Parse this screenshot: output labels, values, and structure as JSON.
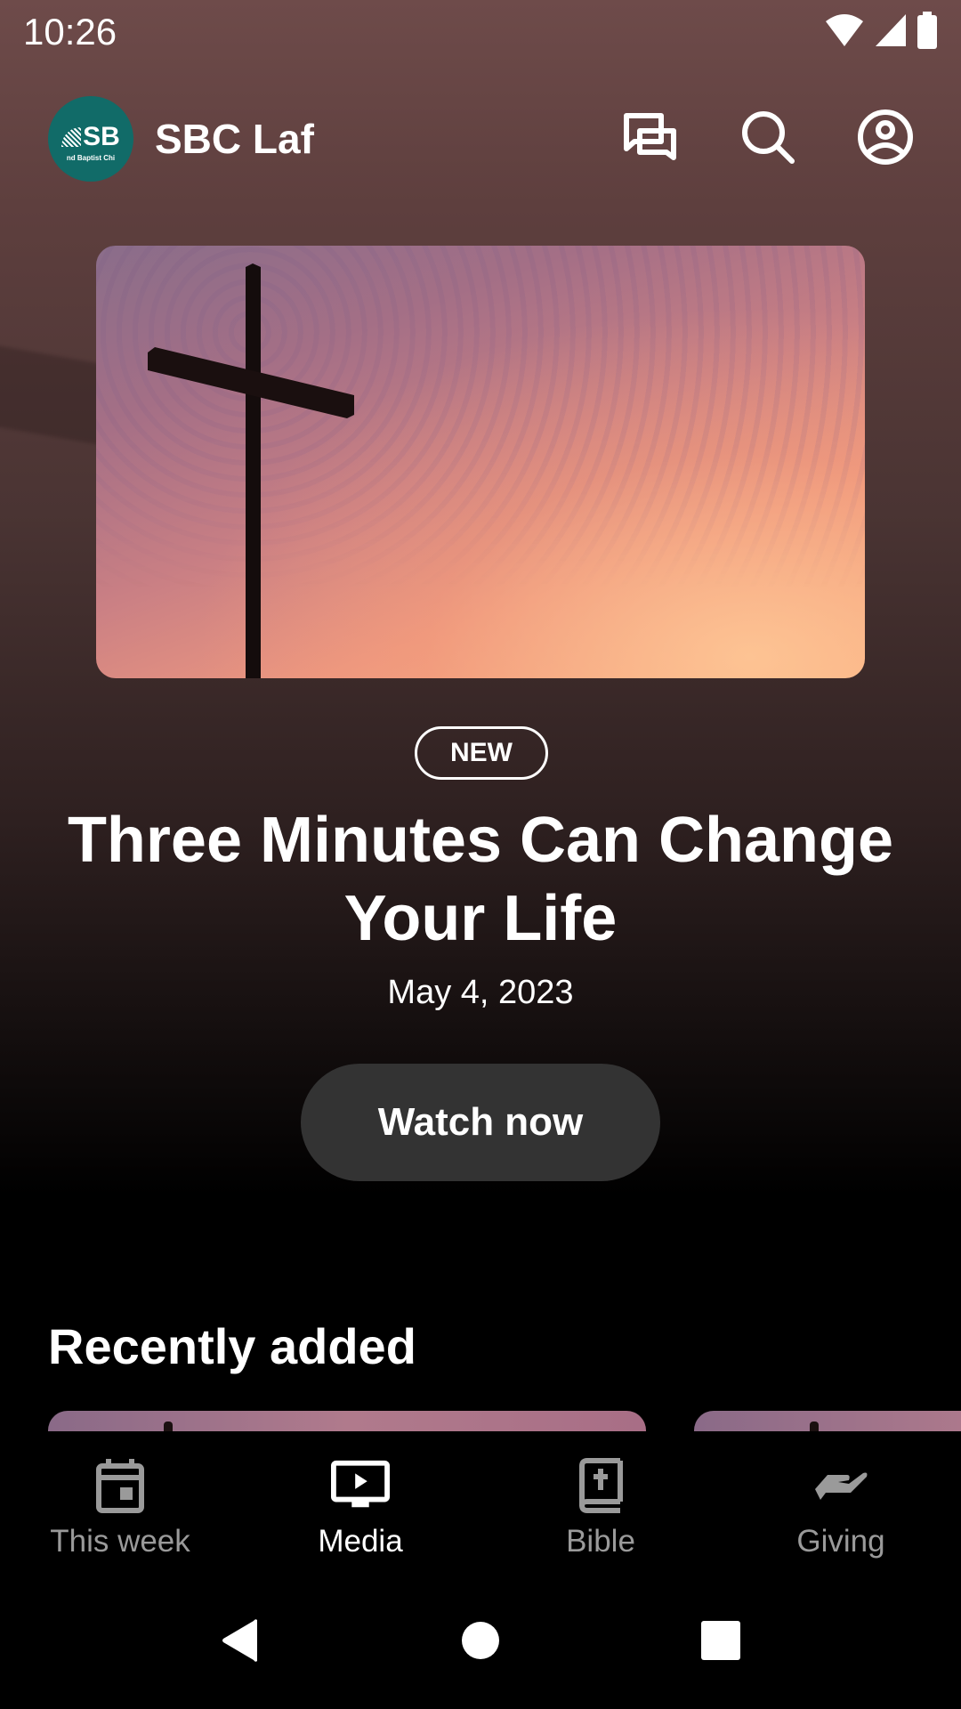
{
  "status_bar": {
    "time": "10:26",
    "icons": [
      "wifi-icon",
      "cellular-signal-icon",
      "battery-icon"
    ]
  },
  "header": {
    "logo": {
      "initials": "SB",
      "subtitle": "nd Baptist Chi",
      "color": "#116b68"
    },
    "title": "SBC Laf",
    "actions": [
      {
        "name": "chat-icon",
        "label": "Messages"
      },
      {
        "name": "search-icon",
        "label": "Search"
      },
      {
        "name": "account-icon",
        "label": "Profile"
      }
    ]
  },
  "hero": {
    "image_description": "Cross silhouette against sunset sky",
    "badge": "NEW",
    "title": "Three Minutes Can Change Your Life",
    "date": "May 4, 2023",
    "cta_label": "Watch now"
  },
  "recently_added": {
    "title": "Recently added",
    "items": [
      {
        "thumbnail": "cross-sunset"
      },
      {
        "thumbnail": "cross-sunset"
      }
    ]
  },
  "bottom_nav": {
    "items": [
      {
        "label": "This week",
        "icon": "calendar-icon",
        "active": false
      },
      {
        "label": "Media",
        "icon": "tv-play-icon",
        "active": true
      },
      {
        "label": "Bible",
        "icon": "bible-icon",
        "active": false
      },
      {
        "label": "Giving",
        "icon": "giving-hand-icon",
        "active": false
      }
    ],
    "active_color": "#ffffff",
    "inactive_color": "#9a9a9a"
  },
  "system_nav": {
    "buttons": [
      "back",
      "home",
      "recents"
    ]
  }
}
